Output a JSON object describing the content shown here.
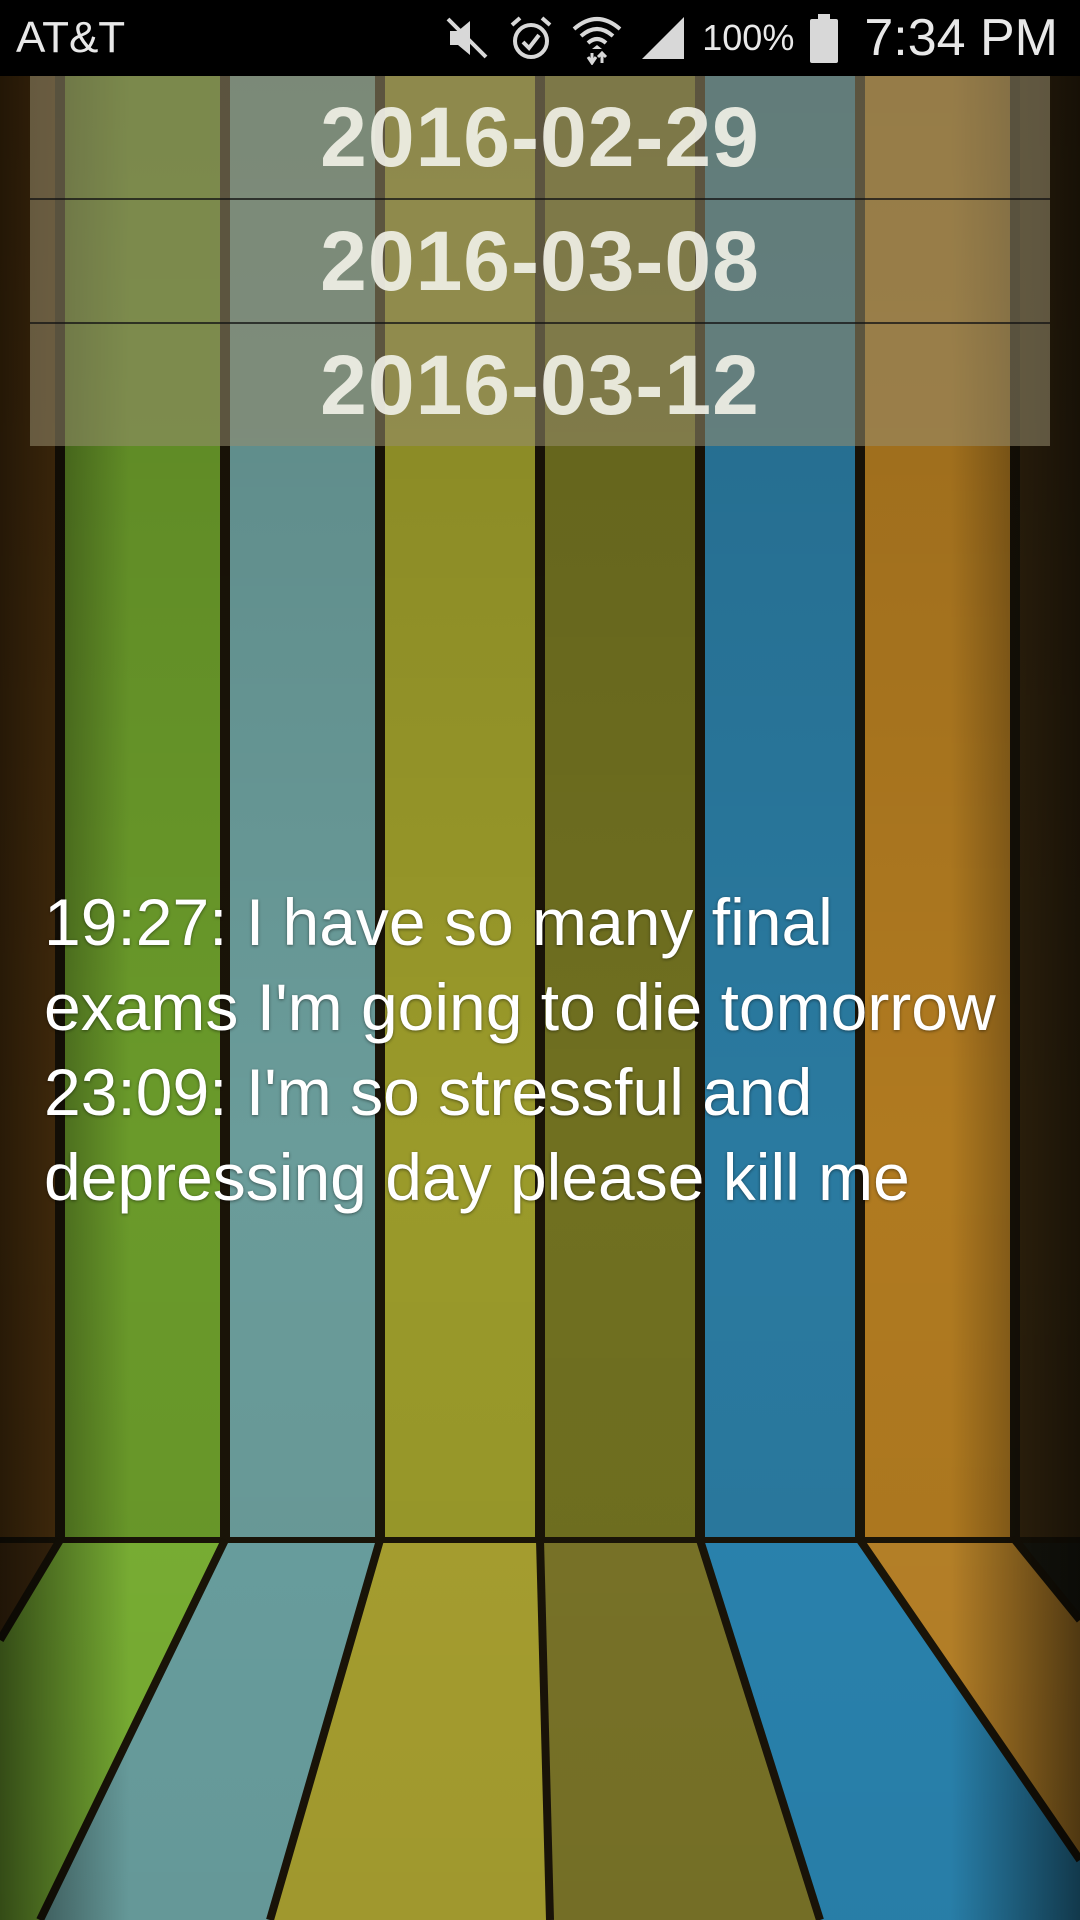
{
  "status_bar": {
    "carrier": "AT&T",
    "battery_percent": "100%",
    "time": "7:34 PM",
    "icons": [
      "mute-icon",
      "alarm-icon",
      "wifi-icon",
      "signal-icon",
      "battery-icon"
    ]
  },
  "dates": [
    {
      "label": "2016-02-29"
    },
    {
      "label": "2016-03-08"
    },
    {
      "label": "2016-03-12"
    }
  ],
  "diary": {
    "entries": [
      {
        "text": "19:27: I have so many final exams I'm going to die tomorrow"
      },
      {
        "text": "23:09: I'm so stressful and depressing day please kill me"
      }
    ]
  },
  "colors": {
    "status_bar_bg": "#000000",
    "date_row_bg": "rgba(150,140,110,0.55)",
    "text": "#ffffff"
  }
}
